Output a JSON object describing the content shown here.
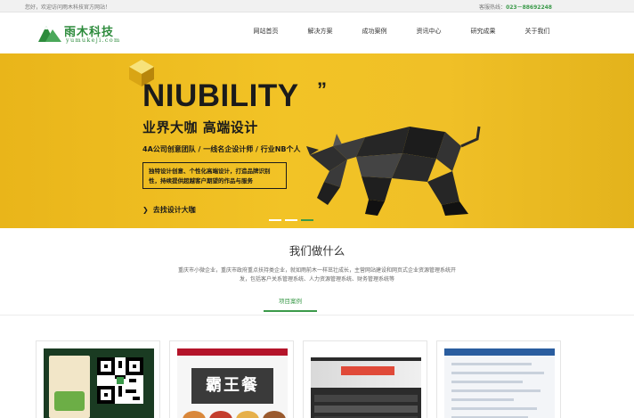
{
  "topbar": {
    "welcome": "您好，欢迎访问雨木科技官方网站！",
    "hotline_label": "客服热线：",
    "phone": "023－88692248"
  },
  "logo": {
    "name": "雨木科技",
    "domain": "yumukeji.com"
  },
  "nav": {
    "items": [
      {
        "label": "网站首页"
      },
      {
        "label": "解决方案"
      },
      {
        "label": "成功案例"
      },
      {
        "label": "资讯中心"
      },
      {
        "label": "研究成果"
      },
      {
        "label": "关于我们"
      }
    ]
  },
  "banner": {
    "headline": "NIUBILITY",
    "quote_mark": "”",
    "subheadline": "业界大咖 高端设计",
    "tagline": "4A公司创意团队 / 一线名企设计师 / 行业NB个人",
    "box_text": "独特设计创意、个性化高端设计，打造品牌识别性，持续提供超越客户期望的作品与服务",
    "cta": "去找设计大咖",
    "slides_total": 3,
    "slide_active": 3
  },
  "section": {
    "title": "我们做什么",
    "description": "重庆市小微企业，重庆市政府重点扶持类企业，就如雨前木一样茁壮成长，主营网站建设和网页式企业资源管理系统开发，包括客户关系管理系统、人力资源管理系统、财务管理系统等",
    "tab": "项目案例"
  },
  "colors": {
    "accent_green": "#3b9a4a",
    "banner_yellow": "#f2c326"
  }
}
